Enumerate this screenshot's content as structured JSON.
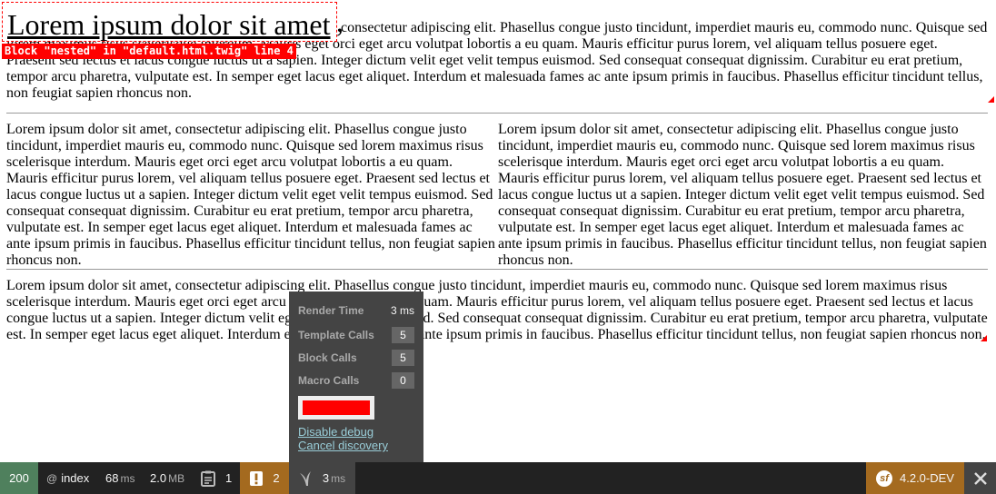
{
  "page": {
    "title": "Lorem ipsum dolor sit amet",
    "title_comma": ",",
    "block_label": "Block \"nested\" in \"default.html.twig\" line 4",
    "para_first_rest": "consectetur adipiscing elit. Phasellus congue justo tincidunt, imperdiet mauris eu, commodo nunc. Quisque sed lorem maximus risus scelerisque interdum. Mauris eget orci eget arcu volutpat lobortis a eu quam. Mauris efficitur purus lorem, vel aliquam tellus posuere eget. Praesent sed lectus et lacus congue luctus ut a sapien. Integer dictum velit eget velit tempus euismod. Sed consequat consequat dignissim. Curabitur eu erat pretium, tempor arcu pharetra, vulputate est. In semper eget lacus eget aliquet. Interdum et malesuada fames ac ante ipsum primis in faucibus. Phasellus efficitur tincidunt tellus, non feugiat sapien rhoncus non.",
    "lorem": "Lorem ipsum dolor sit amet, consectetur adipiscing elit. Phasellus congue justo tincidunt, imperdiet mauris eu, commodo nunc. Quisque sed lorem maximus risus scelerisque interdum. Mauris eget orci eget arcu volutpat lobortis a eu quam. Mauris efficitur purus lorem, vel aliquam tellus posuere eget. Praesent sed lectus et lacus congue luctus ut a sapien. Integer dictum velit eget velit tempus euismod. Sed consequat consequat dignissim. Curabitur eu erat pretium, tempor arcu pharetra, vulputate est. In semper eget lacus eget aliquet. Interdum et malesuada fames ac ante ipsum primis in faucibus. Phasellus efficitur tincidunt tellus, non feugiat sapien rhoncus non."
  },
  "panel": {
    "render_time_label": "Render Time",
    "render_time_value": "3 ms",
    "template_calls_label": "Template Calls",
    "template_calls_value": "5",
    "block_calls_label": "Block Calls",
    "block_calls_value": "5",
    "macro_calls_label": "Macro Calls",
    "macro_calls_value": "0",
    "swatch_color": "#ff0000",
    "disable_debug": "Disable debug",
    "cancel_discovery": "Cancel discovery"
  },
  "toolbar": {
    "status_code": "200",
    "route_at": "@",
    "route_name": "index",
    "time_value": "68",
    "time_unit": "ms",
    "memory_value": "2.0",
    "memory_unit": "MB",
    "forms_count": "1",
    "logs_count": "2",
    "twig_value": "3",
    "twig_unit": "ms",
    "version": "4.2.0-DEV",
    "sf_logo_text": "sf",
    "colors": {
      "bar": "#222222",
      "status_ok": "#4f805d",
      "warning": "#a46a1f",
      "active": "#444444"
    },
    "icons": [
      "forms-icon",
      "logs-icon",
      "twig-icon",
      "symfony-icon",
      "close-icon"
    ]
  }
}
